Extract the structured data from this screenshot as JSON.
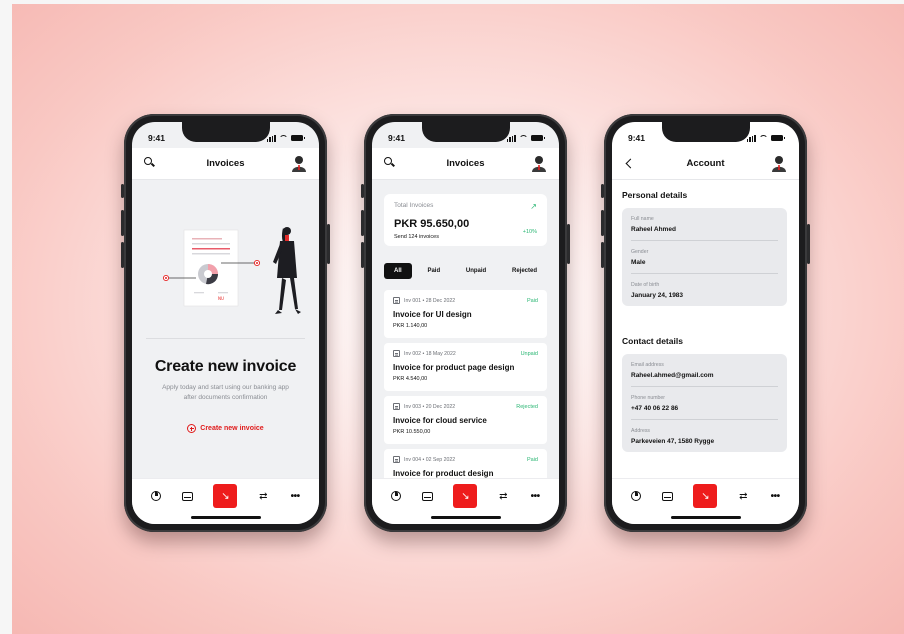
{
  "common": {
    "time": "9:41",
    "accent": "#ee1c1c",
    "tab_icons": [
      "pie-chart-icon",
      "tray-icon",
      "transfer-icon",
      "swap-icon",
      "more-icon"
    ]
  },
  "phone1": {
    "title": "Invoices",
    "heading": "Create new invoice",
    "subtitle_line1": "Apply today and start using our banking app",
    "subtitle_line2": "after documents confirmation",
    "cta": "Create new invoice"
  },
  "phone2": {
    "title": "Invoices",
    "summary": {
      "label": "Total Invoices",
      "amount": "PKR 95.650,00",
      "sent": "Send 124 invoices",
      "change": "+10%",
      "arrow": "↗"
    },
    "filters": [
      {
        "label": "All",
        "active": true
      },
      {
        "label": "Paid",
        "active": false
      },
      {
        "label": "Unpaid",
        "active": false
      },
      {
        "label": "Rejected",
        "active": false
      }
    ],
    "invoices": [
      {
        "meta": "Inv 001  •  28 Dec 2022",
        "status": "Paid",
        "status_color": "#2ab673",
        "title": "Invoice for UI design",
        "amount": "PKR 1.140,00"
      },
      {
        "meta": "Inv 002  •  18 May 2022",
        "status": "Unpaid",
        "status_color": "#2ab673",
        "title": "Invoice for product page design",
        "amount": "PKR 4.540,00"
      },
      {
        "meta": "Inv 003  •  20 Dec 2022",
        "status": "Rejected",
        "status_color": "#2ab673",
        "title": "Invoice for cloud service",
        "amount": "PKR 10.550,00"
      },
      {
        "meta": "Inv 004  •  02 Sep 2022",
        "status": "Paid",
        "status_color": "#2ab673",
        "title": "Invoice for product design",
        "amount": ""
      }
    ]
  },
  "phone3": {
    "title": "Account",
    "personal_title": "Personal details",
    "personal": [
      {
        "label": "Full name",
        "value": "Raheel Ahmed"
      },
      {
        "label": "Gender",
        "value": "Male"
      },
      {
        "label": "Date of birth",
        "value": "January 24, 1983"
      }
    ],
    "contact_title": "Contact details",
    "contact": [
      {
        "label": "Email address",
        "value": "Raheel.ahmed@gmail.com"
      },
      {
        "label": "Phone number",
        "value": "+47 40 06 22 86"
      },
      {
        "label": "Address",
        "value": "Parkeveien 47, 1580 Rygge"
      }
    ]
  }
}
